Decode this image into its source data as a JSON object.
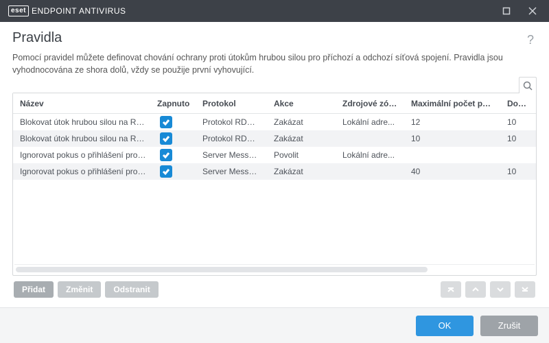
{
  "titlebar": {
    "brand_logo": "eset",
    "brand_product": "ENDPOINT ANTIVIRUS"
  },
  "page": {
    "heading": "Pravidla",
    "help_tooltip": "?",
    "description": "Pomocí pravidel můžete definovat chování ochrany proti útokům hrubou silou pro příchozí a odchozí síťová spojení. Pravidla jsou vyhodnocována ze shora dolů, vždy se použije první vyhovující."
  },
  "table": {
    "columns": {
      "name": "Název",
      "enabled": "Zapnuto",
      "protocol": "Protokol",
      "action": "Akce",
      "source_zones": "Zdrojové zóny",
      "max_attempts": "Maximální počet pokusů",
      "retention": "Doba uchováv..."
    },
    "rows": [
      {
        "name": "Blokovat útok hrubou silou na RDP...",
        "enabled": true,
        "protocol": "Protokol RDP ...",
        "action": "Zakázat",
        "source_zones": "Lokální adre...",
        "max_attempts": "12",
        "retention": "10"
      },
      {
        "name": "Blokovat útok hrubou silou na RDP...",
        "enabled": true,
        "protocol": "Protokol RDP ...",
        "action": "Zakázat",
        "source_zones": "",
        "max_attempts": "10",
        "retention": "10"
      },
      {
        "name": "Ignorovat pokus o přihlášení prostř...",
        "enabled": true,
        "protocol": "Server Messa...",
        "action": "Povolit",
        "source_zones": "Lokální adre...",
        "max_attempts": "",
        "retention": ""
      },
      {
        "name": "Ignorovat pokus o přihlášení prostř...",
        "enabled": true,
        "protocol": "Server Messa...",
        "action": "Zakázat",
        "source_zones": "",
        "max_attempts": "40",
        "retention": "10"
      }
    ]
  },
  "panel_buttons": {
    "add": "Přidat",
    "edit": "Změnit",
    "delete": "Odstranit"
  },
  "footer": {
    "ok": "OK",
    "cancel": "Zrušit"
  }
}
